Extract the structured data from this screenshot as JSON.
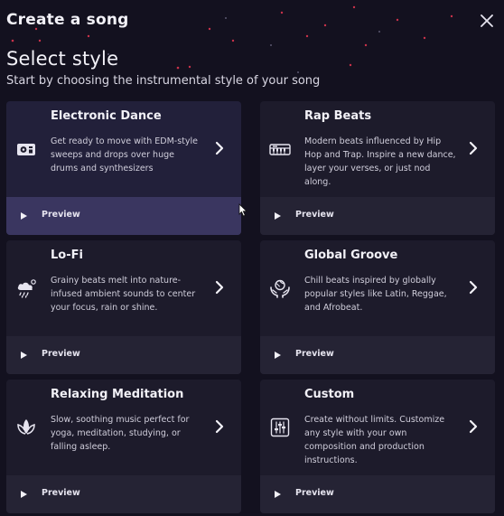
{
  "header": {
    "title": "Create a song",
    "close_icon": "close-icon"
  },
  "section": {
    "title": "Select style",
    "subtitle": "Start by choosing the instrumental style of your song"
  },
  "colors": {
    "background": "#13111f",
    "card": "#1d1b2b",
    "preview_bar": "#252334",
    "active_preview_bar": "#3a3660",
    "dots": "#c8324a"
  },
  "styles": [
    {
      "title": "Electronic Dance",
      "description": "Get ready to move with EDM-style sweeps and drops over huge drums and synthesizers",
      "icon": "speaker-icon",
      "preview_label": "Preview",
      "state": "hovered"
    },
    {
      "title": "Rap Beats",
      "description": "Modern beats influenced by Hip Hop and Trap. Inspire a new dance, layer your verses, or just nod along.",
      "icon": "keyboard-icon",
      "preview_label": "Preview"
    },
    {
      "title": "Lo-Fi",
      "description": "Grainy beats melt into nature-infused ambient sounds to center your focus, rain or shine.",
      "icon": "rain-cloud-icon",
      "preview_label": "Preview"
    },
    {
      "title": "Global Groove",
      "description": "Chill beats inspired by globally popular styles like Latin, Reggae, and Afrobeat.",
      "icon": "globe-hands-icon",
      "preview_label": "Preview"
    },
    {
      "title": "Relaxing Meditation",
      "description": "Slow, soothing music perfect for yoga, meditation, studying, or falling asleep.",
      "icon": "lotus-icon",
      "preview_label": "Preview"
    },
    {
      "title": "Custom",
      "description": "Create without limits. Customize any style with your own composition and production instructions.",
      "icon": "sliders-icon",
      "preview_label": "Preview"
    }
  ]
}
